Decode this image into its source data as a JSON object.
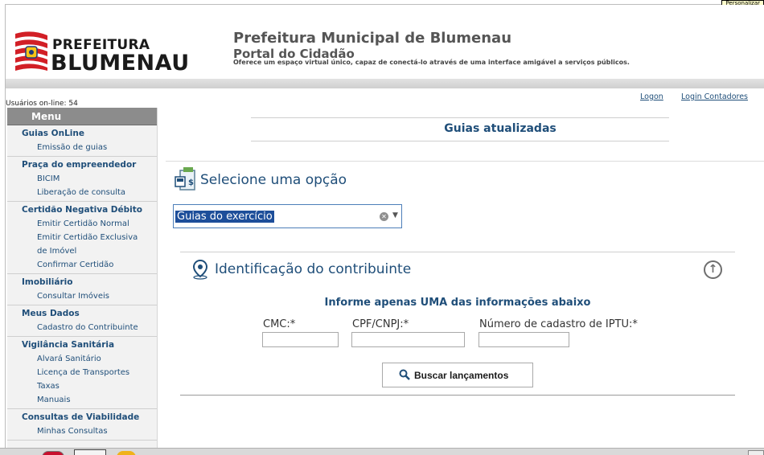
{
  "personalizar": "Personalizar",
  "header": {
    "logo_top": "PREFEITURA",
    "logo_bottom": "BLUMENAU",
    "title": "Prefeitura Municipal de Blumenau",
    "subtitle": "Portal do Cidadão",
    "description": "Oferece um espaço virtual único, capaz de conectá-lo através de uma interface amigável a serviços públicos.",
    "logo_colors": {
      "red": "#d21f26",
      "yellow": "#f6c415",
      "blue": "#1f3b7a"
    }
  },
  "users_online": "Usuários on-line: 54",
  "links": {
    "logon": "Logon",
    "contadores": "Login Contadores"
  },
  "sidebar": {
    "heading": "Menu",
    "groups": [
      {
        "title": "Guias OnLine",
        "items": [
          "Emissão de guias"
        ]
      },
      {
        "title": "Praça do empreendedor",
        "items": [
          "BICIM",
          "Liberação de consulta"
        ]
      },
      {
        "title": "Certidão Negativa Débito",
        "items": [
          "Emitir Certidão Normal",
          "Emitir Certidão Exclusiva",
          "de Imóvel",
          "Confirmar Certidão"
        ]
      },
      {
        "title": "Imobiliário",
        "items": [
          "Consultar Imóveis"
        ]
      },
      {
        "title": "Meus Dados",
        "items": [
          "Cadastro do Contribuinte"
        ]
      },
      {
        "title": "Vigilância Sanitária",
        "items": [
          "Alvará Sanitário",
          "Licença de Transportes",
          "Taxas",
          "Manuais"
        ]
      },
      {
        "title": "Consultas de Viabilidade",
        "items": [
          "Minhas Consultas"
        ]
      }
    ]
  },
  "main": {
    "page_title": "Guias atualizadas",
    "option_title": "Selecione uma opção",
    "select_value": "Guias do exercício",
    "panel": {
      "title": "Identificação do contribuinte",
      "hint": "Informe apenas UMA das informações abaixo",
      "fields": {
        "cmc": "CMC:*",
        "cpf": "CPF/CNPJ:*",
        "iptu": "Número de cadastro de IPTU:*"
      },
      "search_button": "Buscar lançamentos"
    }
  },
  "icons": {
    "logo": "blumenau-flag-icon",
    "option": "document-money-icon",
    "panel": "location-pin-icon",
    "collapse": "arrow-up-circle-icon",
    "search": "search-icon"
  },
  "colors": {
    "link_blue": "#1f4e79",
    "menu_header": "#8c8c8c",
    "selection": "#1d4e9a"
  }
}
